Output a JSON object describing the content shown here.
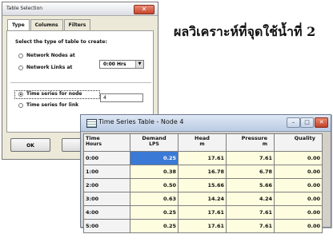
{
  "dialog": {
    "title": "Table Selection",
    "close_glyph": "✕",
    "tabs": [
      "Type",
      "Columns",
      "Filters"
    ],
    "prompt": "Select the type of table to create:",
    "option_nodes": "Network Nodes at",
    "option_links": "Network Links at",
    "time_select_value": "0:00 Hrs",
    "option_node_series": "Time series for node",
    "option_link_series": "Time series for link",
    "node_input_value": "4",
    "ok_label": "OK",
    "cancel_label_partial": "C"
  },
  "heading": "ผลวิเคราะห์ที่จุดใช้น้ำที่ 2",
  "timeseries": {
    "title": "Time Series Table - Node 4",
    "columns": [
      {
        "label": "Time",
        "unit": "Hours"
      },
      {
        "label": "Demand",
        "unit": "LPS"
      },
      {
        "label": "Head",
        "unit": "m"
      },
      {
        "label": "Pressure",
        "unit": "m"
      },
      {
        "label": "Quality",
        "unit": ""
      }
    ],
    "rows": [
      [
        "0:00",
        "0.25",
        "17.61",
        "7.61",
        "0.00"
      ],
      [
        "1:00",
        "0.38",
        "16.78",
        "6.78",
        "0.00"
      ],
      [
        "2:00",
        "0.50",
        "15.66",
        "5.66",
        "0.00"
      ],
      [
        "3:00",
        "0.63",
        "14.24",
        "4.24",
        "0.00"
      ],
      [
        "4:00",
        "0.25",
        "17.61",
        "7.61",
        "0.00"
      ],
      [
        "5:00",
        "0.25",
        "17.61",
        "7.61",
        "0.00"
      ]
    ],
    "selected_cell": {
      "row": 0,
      "col": 1
    }
  }
}
